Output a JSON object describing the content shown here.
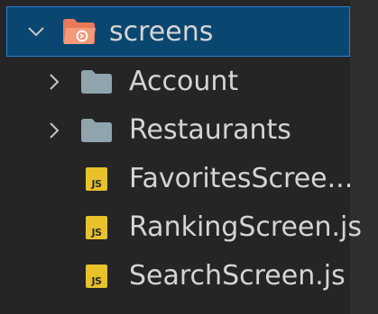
{
  "explorer": {
    "folder": {
      "name": "screens",
      "icon": "folder-open-icon",
      "state": "expanded",
      "selected": true,
      "icon_color": "#e8795a"
    },
    "items": [
      {
        "type": "folder",
        "name": "Account",
        "state": "collapsed",
        "icon": "folder-icon"
      },
      {
        "type": "folder",
        "name": "Restaurants",
        "state": "collapsed",
        "icon": "folder-icon"
      },
      {
        "type": "file",
        "name": "FavoritesScree...",
        "icon": "js-file-icon",
        "badge": "JS"
      },
      {
        "type": "file",
        "name": "RankingScreen.js",
        "icon": "js-file-icon",
        "badge": "JS"
      },
      {
        "type": "file",
        "name": "SearchScreen.js",
        "icon": "js-file-icon",
        "badge": "JS"
      }
    ],
    "colors": {
      "background": "#252526",
      "selection": "#094771",
      "selection_border": "#2e7fd6",
      "folder": "#90a4ae",
      "js_badge": "#e8c12b"
    }
  }
}
